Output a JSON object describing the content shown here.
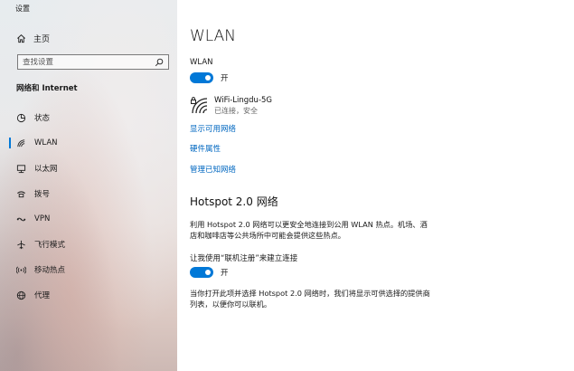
{
  "window": {
    "title": "设置"
  },
  "sidebar": {
    "home_label": "主页",
    "search": {
      "placeholder": "查找设置"
    },
    "section_title": "网络和 Internet",
    "items": [
      {
        "label": "状态",
        "icon": "status-icon"
      },
      {
        "label": "WLAN",
        "icon": "wifi-icon",
        "active": true
      },
      {
        "label": "以太网",
        "icon": "ethernet-icon"
      },
      {
        "label": "拨号",
        "icon": "dialup-icon"
      },
      {
        "label": "VPN",
        "icon": "vpn-icon"
      },
      {
        "label": "飞行模式",
        "icon": "airplane-icon"
      },
      {
        "label": "移动热点",
        "icon": "hotspot-icon"
      },
      {
        "label": "代理",
        "icon": "globe-icon"
      }
    ]
  },
  "main": {
    "title": "WLAN",
    "wlan_toggle": {
      "label": "WLAN",
      "state": "开"
    },
    "network": {
      "name": "WiFi-Lingdu-5G",
      "status": "已连接，安全"
    },
    "links": {
      "show_networks": "显示可用网络",
      "hardware": "硬件属性",
      "manage_known": "管理已知网络"
    },
    "hotspot": {
      "title": "Hotspot 2.0 网络",
      "description": "利用 Hotspot 2.0 网络可以更安全地连接到公用 WLAN 热点。机场、酒店和咖啡店等公共场所中可能会提供这些热点。",
      "toggle_label": "让我使用“联机注册”来建立连接",
      "toggle_state": "开",
      "note": "当你打开此项并选择 Hotspot 2.0 网络时，我们将显示可供选择的提供商列表，以便你可以联机。"
    }
  },
  "colors": {
    "accent": "#0078d7",
    "link": "#0067c0"
  }
}
